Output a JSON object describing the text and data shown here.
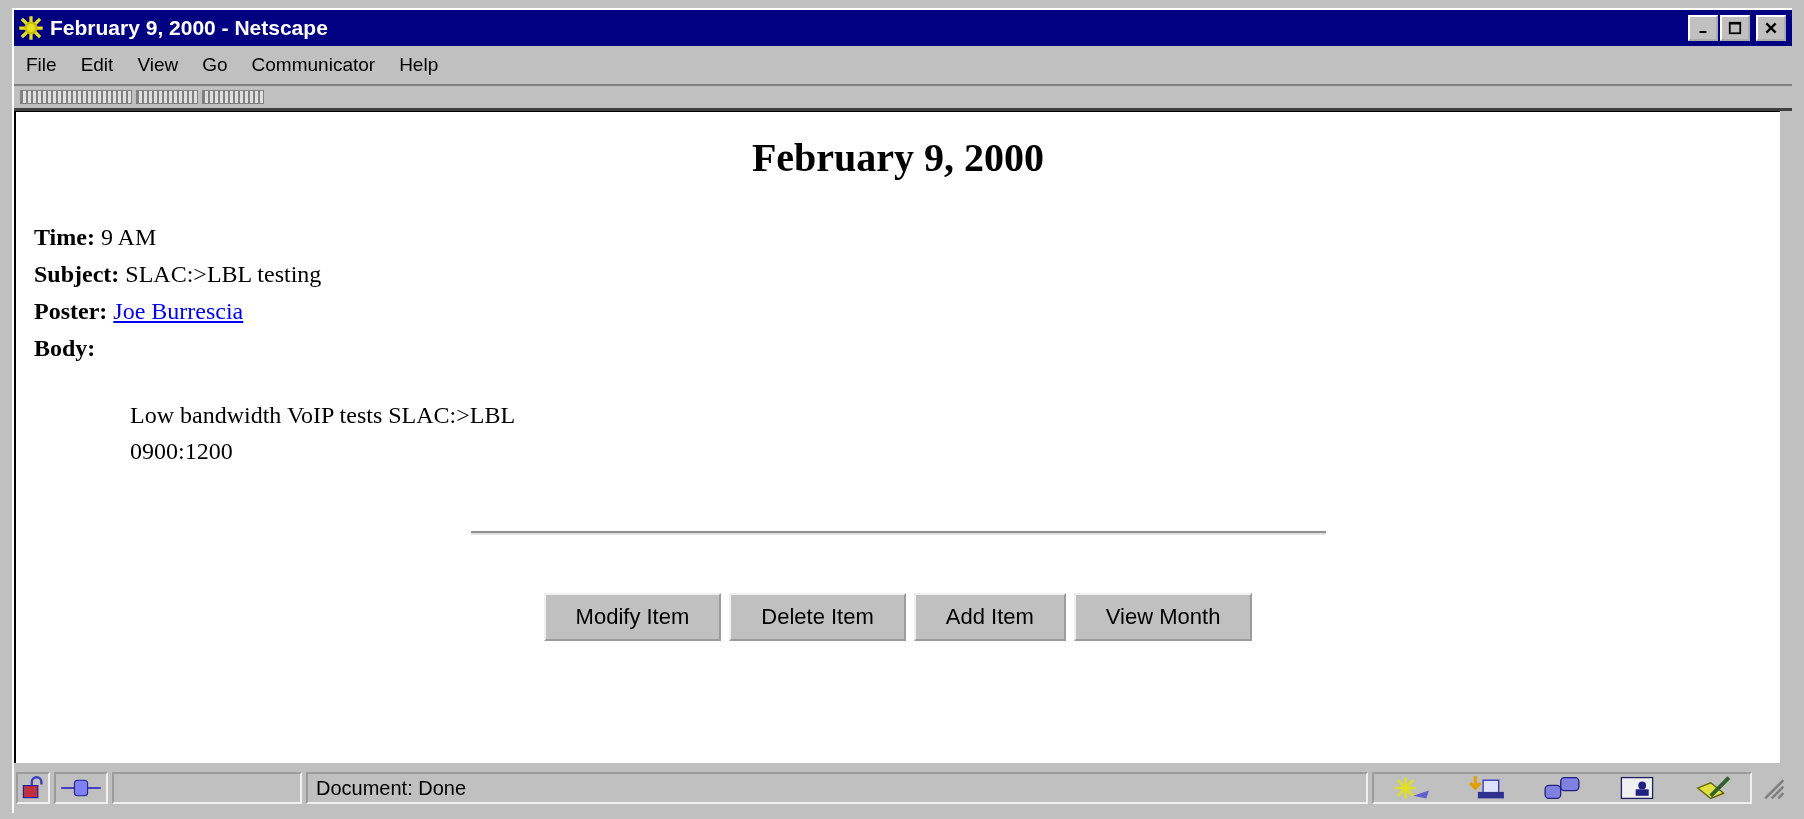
{
  "window": {
    "title": "February 9, 2000 - Netscape"
  },
  "menu": [
    "File",
    "Edit",
    "View",
    "Go",
    "Communicator",
    "Help"
  ],
  "page": {
    "heading": "February 9, 2000",
    "fields": [
      {
        "label": "Time:",
        "value": "9 AM",
        "kind": "text"
      },
      {
        "label": "Subject:",
        "value": "SLAC:>LBL testing",
        "kind": "text"
      },
      {
        "label": "Poster:",
        "value": "Joe Burrescia",
        "kind": "link"
      },
      {
        "label": "Body:"
      }
    ],
    "body": [
      "Low bandwidth VoIP tests SLAC:>LBL",
      "0900:1200"
    ],
    "buttons": [
      "Modify Item",
      "Delete Item",
      "Add Item",
      "View Month"
    ]
  },
  "status_bar": {
    "text": "Document: Done"
  }
}
